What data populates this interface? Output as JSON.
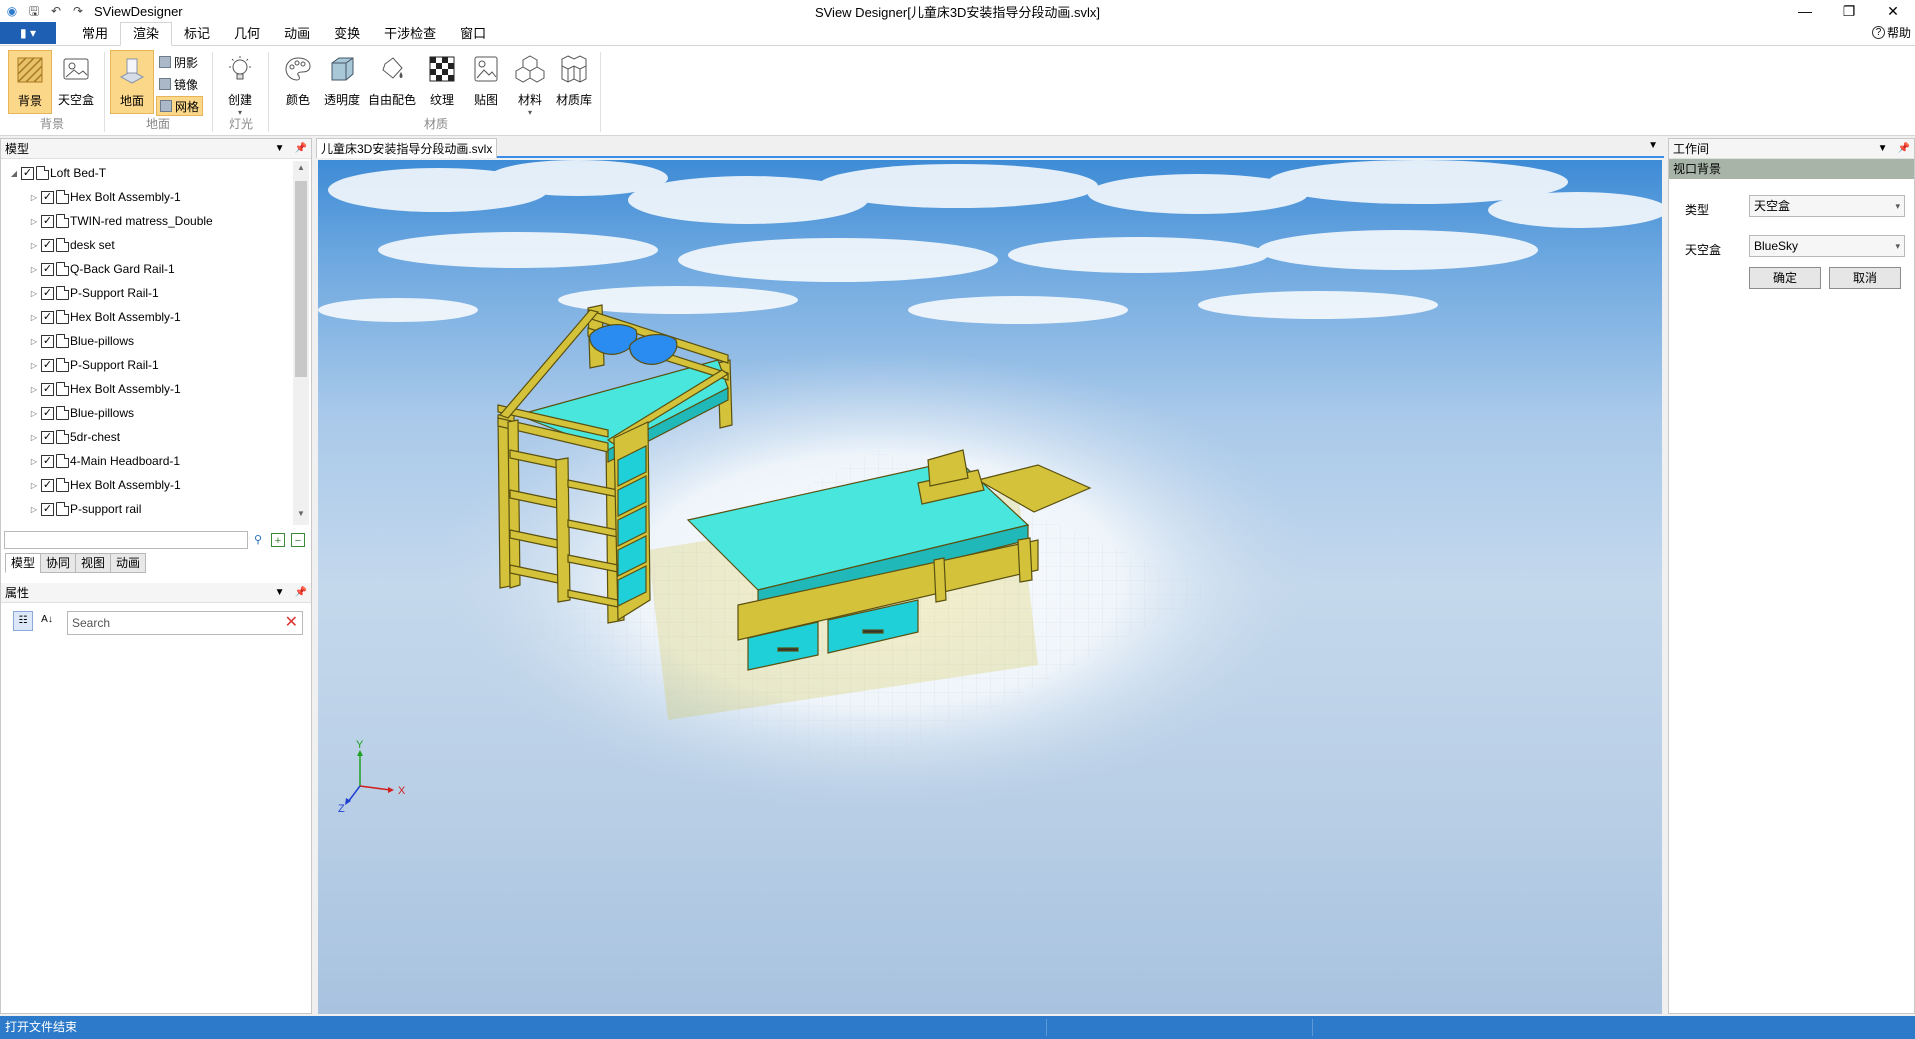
{
  "titlebar": {
    "app_name": "SViewDesigner",
    "window_title": "SView Designer[儿童床3D安装指导分段动画.svlx]",
    "minimize": "—",
    "restore": "❐",
    "close": "✕"
  },
  "menu": {
    "file_icon": "file-menu-icon",
    "tabs": [
      "常用",
      "渲染",
      "标记",
      "几何",
      "动画",
      "变换",
      "干涉检查",
      "窗口"
    ],
    "active_tab": "渲染",
    "help": "帮助"
  },
  "ribbon": {
    "groups": {
      "background": {
        "label": "背景",
        "buttons": [
          {
            "label": "背景",
            "icon": "background-icon",
            "selected": true
          },
          {
            "label": "天空盒",
            "icon": "skybox-icon",
            "selected": false
          }
        ]
      },
      "ground": {
        "label": "地面",
        "main": {
          "label": "地面",
          "icon": "ground-icon",
          "selected": true
        },
        "small": [
          {
            "label": "阴影",
            "icon": "shadow-icon",
            "selected": false
          },
          {
            "label": "镜像",
            "icon": "mirror-icon",
            "selected": false
          },
          {
            "label": "网格",
            "icon": "grid-icon",
            "selected": true
          }
        ]
      },
      "light": {
        "label": "灯光",
        "buttons": [
          {
            "label": "创建",
            "icon": "lightbulb-icon"
          }
        ]
      },
      "material": {
        "label": "材质",
        "buttons": [
          {
            "label": "颜色",
            "icon": "palette-icon"
          },
          {
            "label": "透明度",
            "icon": "transparency-icon"
          },
          {
            "label": "自由配色",
            "icon": "paint-bucket-icon"
          },
          {
            "label": "纹理",
            "icon": "texture-icon"
          },
          {
            "label": "贴图",
            "icon": "image-map-icon"
          },
          {
            "label": "材料",
            "icon": "material-icon"
          },
          {
            "label": "材质库",
            "icon": "material-library-icon"
          }
        ]
      }
    }
  },
  "left_panel": {
    "model_header": "模型",
    "tree": {
      "root": "Loft Bed-T",
      "children": [
        "Hex Bolt Assembly-1",
        "TWIN-red matress_Double",
        "desk set",
        "Q-Back Gard Rail-1",
        "P-Support Rail-1",
        "Hex Bolt Assembly-1",
        "Blue-pillows",
        "P-Support Rail-1",
        "Hex Bolt Assembly-1",
        "Blue-pillows",
        "5dr-chest",
        "4-Main Headboard-1",
        "Hex Bolt Assembly-1",
        "P-support rail"
      ]
    },
    "search_placeholder": "",
    "tabs": [
      "模型",
      "协同",
      "视图",
      "动画"
    ],
    "active_tab": "模型",
    "properties_header": "属性",
    "prop_search_placeholder": "Search"
  },
  "document": {
    "tab_title": "儿童床3D安装指导分段动画.svlx"
  },
  "viewport": {
    "axis_labels": {
      "x": "X",
      "y": "Y",
      "z": "Z"
    },
    "colors": {
      "frame": "#d4c23a",
      "mattress": "#48e6dc",
      "pillow": "#2a8cf0",
      "drawer": "#20d0d8"
    }
  },
  "right_panel": {
    "header": "工作间",
    "section": "视口背景",
    "type_label": "类型",
    "type_value": "天空盒",
    "skybox_label": "天空盒",
    "skybox_value": "BlueSky",
    "ok": "确定",
    "cancel": "取消"
  },
  "status": {
    "message": "打开文件结束"
  }
}
